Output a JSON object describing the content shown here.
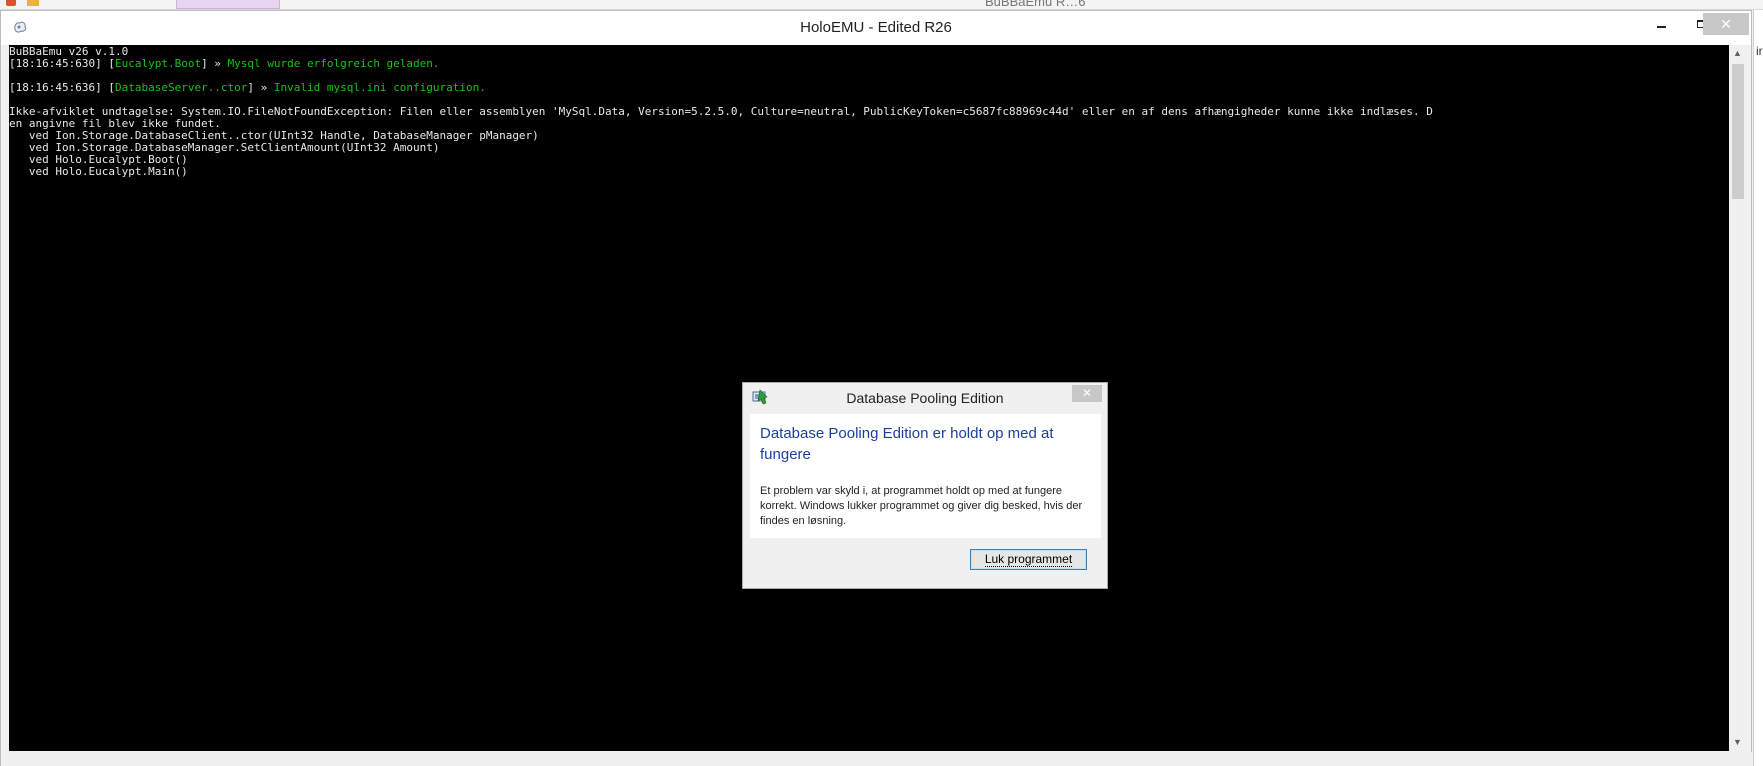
{
  "background": {
    "title_fragment": "BuBBaEmu R…6",
    "right_edge_text": "ir"
  },
  "window": {
    "title": "HoloEMU - Edited R26",
    "icon": "holo-app-icon",
    "controls": {
      "minimize_icon": "minimize-icon",
      "maximize_icon": "maximize-icon",
      "close_glyph": "✕"
    }
  },
  "console": {
    "lines": [
      {
        "parts": [
          {
            "text": "BuBBaEmu v26 v.1.0",
            "color": "w"
          }
        ]
      },
      {
        "parts": [
          {
            "text": "[18:16:45:630] [",
            "color": "w"
          },
          {
            "text": "Eucalypt.Boot",
            "color": "g"
          },
          {
            "text": "] » ",
            "color": "w"
          },
          {
            "text": "Mysql wurde erfolgreich geladen.",
            "color": "g"
          }
        ]
      },
      {
        "parts": []
      },
      {
        "parts": [
          {
            "text": "[18:16:45:636] [",
            "color": "w"
          },
          {
            "text": "DatabaseServer..ctor",
            "color": "g"
          },
          {
            "text": "] » ",
            "color": "w"
          },
          {
            "text": "Invalid mysql.ini configuration.",
            "color": "g"
          }
        ]
      },
      {
        "parts": []
      },
      {
        "parts": [
          {
            "text": "Ikke-afviklet undtagelse: System.IO.FileNotFoundException: Filen eller assemblyen 'MySql.Data, Version=5.2.5.0, Culture=neutral, PublicKeyToken=c5687fc88969c44d' eller en af dens afhængigheder kunne ikke indlæses. D",
            "color": "w"
          }
        ]
      },
      {
        "parts": [
          {
            "text": "en angivne fil blev ikke fundet.",
            "color": "w"
          }
        ]
      },
      {
        "parts": [
          {
            "text": "   ved Ion.Storage.DatabaseClient..ctor(UInt32 Handle, DatabaseManager pManager)",
            "color": "w"
          }
        ]
      },
      {
        "parts": [
          {
            "text": "   ved Ion.Storage.DatabaseManager.SetClientAmount(UInt32 Amount)",
            "color": "w"
          }
        ]
      },
      {
        "parts": [
          {
            "text": "   ved Holo.Eucalypt.Boot()",
            "color": "w"
          }
        ]
      },
      {
        "parts": [
          {
            "text": "   ved Holo.Eucalypt.Main()",
            "color": "w"
          }
        ]
      }
    ]
  },
  "scrollbar": {
    "up_arrow": "▲",
    "down_arrow": "▼"
  },
  "dialog": {
    "title": "Database Pooling Edition",
    "close_glyph": "✕",
    "heading": "Database Pooling Edition er holdt op med at fungere",
    "message": "Et problem var skyld i, at programmet holdt op med at fungere korrekt. Windows lukker programmet og giver dig besked, hvis der findes en løsning.",
    "button_label": "Luk programmet",
    "icon": "app-error-icon"
  }
}
